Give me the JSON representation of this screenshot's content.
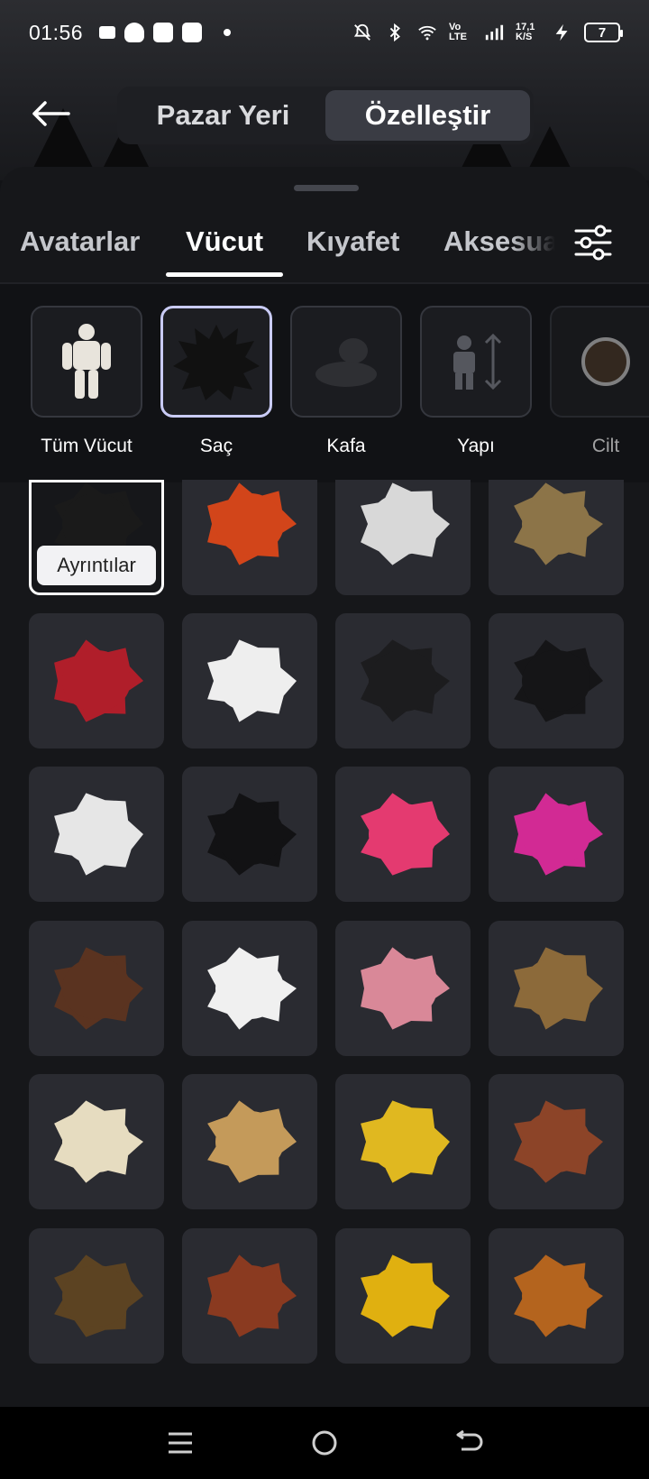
{
  "status_bar": {
    "time": "01:56",
    "network": "Vo LTE",
    "speed": "17,1 K/S",
    "battery": "7"
  },
  "header": {
    "back_icon": "arrow-left-icon",
    "segments": [
      "Pazar Yeri",
      "Özelleştir"
    ],
    "active_segment": "Özelleştir"
  },
  "tabs": {
    "items": [
      "Avatarlar",
      "Vücut",
      "Kıyafet",
      "Aksesuar"
    ],
    "active": "Vücut",
    "filter_icon": "sliders-icon"
  },
  "categories": {
    "items": [
      {
        "label": "Tüm Vücut",
        "icon": "full-body-icon"
      },
      {
        "label": "Saç",
        "icon": "hair-icon"
      },
      {
        "label": "Kafa",
        "icon": "head-icon"
      },
      {
        "label": "Yapı",
        "icon": "body-scale-icon"
      },
      {
        "label": "Cilt",
        "icon": "skin-tone-icon"
      }
    ],
    "active": "Saç"
  },
  "grid": {
    "details_label": "Ayrıntılar",
    "items": [
      {
        "name": "black-spiky-hair",
        "color": "#1a1a1a",
        "selected": true
      },
      {
        "name": "red-ponytail-hair",
        "color": "#d2451a"
      },
      {
        "name": "white-horned-hair",
        "color": "#d8d8d8"
      },
      {
        "name": "blonde-spiky-hair",
        "color": "#8c7448"
      },
      {
        "name": "red-shaggy-hair",
        "color": "#b01e2a"
      },
      {
        "name": "white-spiky-hair",
        "color": "#eeeeee"
      },
      {
        "name": "black-messy-hair",
        "color": "#1c1c1e"
      },
      {
        "name": "black-layered-hair",
        "color": "#151517"
      },
      {
        "name": "white-fluffy-hair",
        "color": "#e6e6e6"
      },
      {
        "name": "black-long-hair",
        "color": "#121214"
      },
      {
        "name": "colorful-fan-accessory",
        "color": "#e43a70"
      },
      {
        "name": "pink-cat-hair",
        "color": "#d22a94"
      },
      {
        "name": "brown-short-hair",
        "color": "#5a3320"
      },
      {
        "name": "white-bowl-hair",
        "color": "#f0f0f0"
      },
      {
        "name": "pink-spiky-hair",
        "color": "#d98898"
      },
      {
        "name": "beads-head-avatar",
        "color": "#8c6a3a"
      },
      {
        "name": "cream-swept-hair",
        "color": "#e6dcc0"
      },
      {
        "name": "tan-short-hair",
        "color": "#c49a5a"
      },
      {
        "name": "yellow-long-hair",
        "color": "#e0b820"
      },
      {
        "name": "auburn-bob-hair",
        "color": "#8c4428"
      },
      {
        "name": "brown-slick-hair",
        "color": "#5c4322"
      },
      {
        "name": "auburn-messy-hair",
        "color": "#8a3a20"
      },
      {
        "name": "gold-spiky-hair",
        "color": "#e0b010"
      },
      {
        "name": "copper-messy-hair",
        "color": "#b4641e"
      }
    ]
  },
  "nav_bar": {
    "icons": [
      "menu-icon",
      "home-circle-icon",
      "back-icon"
    ]
  }
}
